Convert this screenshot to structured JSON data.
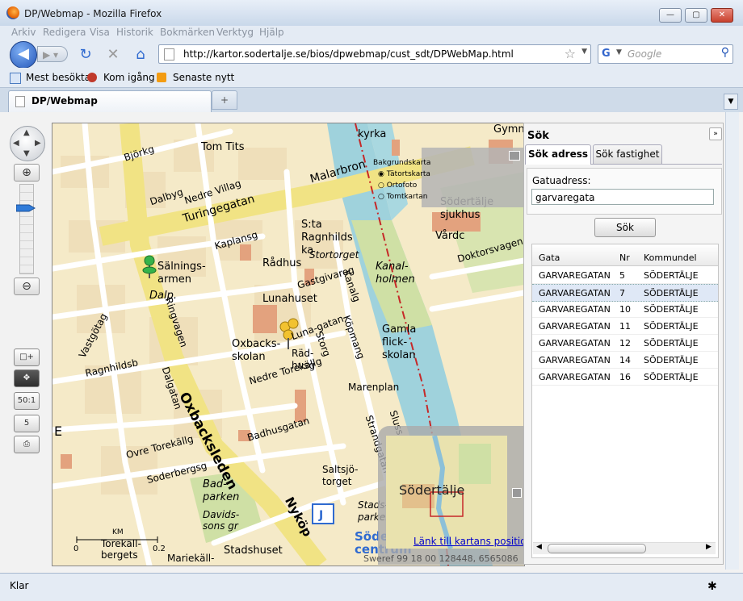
{
  "window": {
    "title": "DP/Webmap - Mozilla Firefox",
    "controls": [
      "minimize",
      "maximize",
      "close"
    ]
  },
  "menu": [
    "Arkiv",
    "Redigera",
    "Visa",
    "Historik",
    "Bokmärken",
    "Verktyg",
    "Hjälp"
  ],
  "nav": {
    "url": "http://kartor.sodertalje.se/bios/dpwebmap/cust_sdt/DPWebMap.html",
    "search_placeholder": "Google"
  },
  "bookmarks": [
    "Mest besökta",
    "Kom igång",
    "Senaste nytt"
  ],
  "tabs": [
    {
      "label": "DP/Webmap"
    }
  ],
  "status": "Klar",
  "map": {
    "layers": {
      "title": "Bakgrundskarta",
      "options": [
        "Tätortskarta",
        "Ortofoto",
        "Tomtkartan"
      ],
      "selected": "Tätortskarta"
    },
    "overview_label": "Södertälje",
    "link": "Länk till kartans position",
    "coords": "Sweref 99 18 00 128448, 6565086",
    "scale_unit": "KM",
    "scale_start": "0",
    "scale_end": "0.2",
    "edge_letter": "E",
    "labels": [
      "Turingegatan",
      "Malarbron",
      "Rådhus",
      "S:ta Ragnhilds ka",
      "Stortorget",
      "Lunahuset",
      "Luna-gatan",
      "Oxbacks-skolan",
      "Oxbacksleden",
      "Nyköp",
      "Kanal-holmen",
      "Gamla flick-skolan",
      "Marenplan",
      "Södertälje sjukhus",
      "Vårdc",
      "Doktorsvagen",
      "Sälnings-armen",
      "Dalp.",
      "Ragnhildsb",
      "Nedre Villag",
      "Dalbyg",
      "Björkg",
      "Tom Tits",
      "Ovre Torekällg",
      "Soderbergsg",
      "Bad-parken",
      "Davids-sons gr",
      "Torekäll-bergets",
      "Mariekäll-",
      "Stadshuset",
      "Saltsjö-torget",
      "Stads-parken",
      "Södertälje centrum",
      "Gymn",
      "kyrka",
      "Nedre Torekällg",
      "Badhusgatan",
      "Strandgatan",
      "Vastgötag",
      "Kaplansg",
      "Gastgivareg",
      "Räd-husg",
      "Kanalg",
      "Köpmang",
      "Storg",
      "Dalgatan",
      "Ringvagen",
      "Sluss"
    ]
  },
  "panel": {
    "title": "Sök",
    "tabs": [
      "Sök adress",
      "Sök fastighet"
    ],
    "active_tab": "Sök adress",
    "field_label": "Gatuadress:",
    "field_value": "garvaregata",
    "button": "Sök",
    "columns": [
      "Gata",
      "Nr",
      "Kommundel"
    ],
    "rows": [
      [
        "GARVAREGATAN",
        "5",
        "SÖDERTÄLJE"
      ],
      [
        "GARVAREGATAN",
        "7",
        "SÖDERTÄLJE"
      ],
      [
        "GARVAREGATAN",
        "10",
        "SÖDERTÄLJE"
      ],
      [
        "GARVAREGATAN",
        "11",
        "SÖDERTÄLJE"
      ],
      [
        "GARVAREGATAN",
        "12",
        "SÖDERTÄLJE"
      ],
      [
        "GARVAREGATAN",
        "14",
        "SÖDERTÄLJE"
      ],
      [
        "GARVAREGATAN",
        "16",
        "SÖDERTÄLJE"
      ]
    ],
    "selected_row": 1
  },
  "colors": {
    "road_major": "#f3e78a",
    "road_minor": "#ffffff",
    "building": "#e5a27e",
    "water": "#9fd2dc",
    "park": "#cfe0a5",
    "block": "#f2e4c3",
    "accent_blue": "#2f6ad0"
  }
}
